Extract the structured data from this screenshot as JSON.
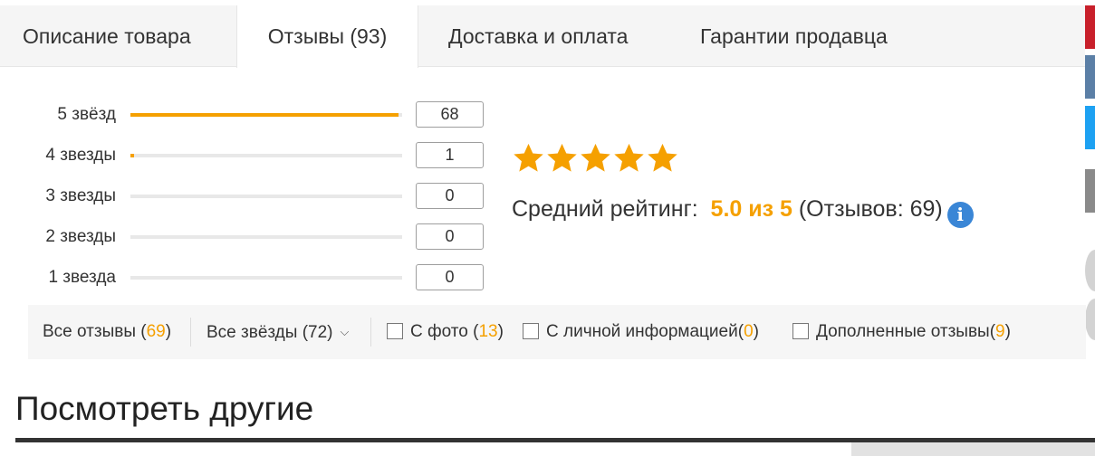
{
  "tabs": [
    {
      "label": "Описание товара"
    },
    {
      "label": "Отзывы (93)",
      "active": true
    },
    {
      "label": "Доставка и оплата"
    },
    {
      "label": "Гарантии продавца"
    }
  ],
  "ratings": [
    {
      "label": "5 звёзд",
      "count": "68",
      "fill_fraction": 0.985
    },
    {
      "label": "4 звезды",
      "count": "1",
      "fill_fraction": 0.014
    },
    {
      "label": "3 звезды",
      "count": "0",
      "fill_fraction": 0
    },
    {
      "label": "2 звезды",
      "count": "0",
      "fill_fraction": 0
    },
    {
      "label": "1 звезда",
      "count": "0",
      "fill_fraction": 0
    }
  ],
  "summary": {
    "stars_filled": 5,
    "avg_label": "Средний рейтинг:",
    "avg_value": "5.0 из 5",
    "reviews_count_text": "(Отзывов: 69)",
    "info_glyph": "i",
    "star_color": "#f5a000"
  },
  "filters": {
    "all_reviews_label": "Все отзывы (",
    "all_reviews_count": "69",
    "all_stars_label": "Все звёзды (72)",
    "with_photo_label": "С фото (",
    "with_photo_count": "13",
    "personal_info_label": "С личной информацией(",
    "personal_info_count": "0",
    "supplemented_label": "Дополненные отзывы(",
    "supplemented_count": "9",
    "close_paren": ")"
  },
  "see_others": {
    "title": "Посмотреть другие"
  },
  "colors": {
    "accent": "#f5a000",
    "info_blue": "#3a86d6"
  }
}
